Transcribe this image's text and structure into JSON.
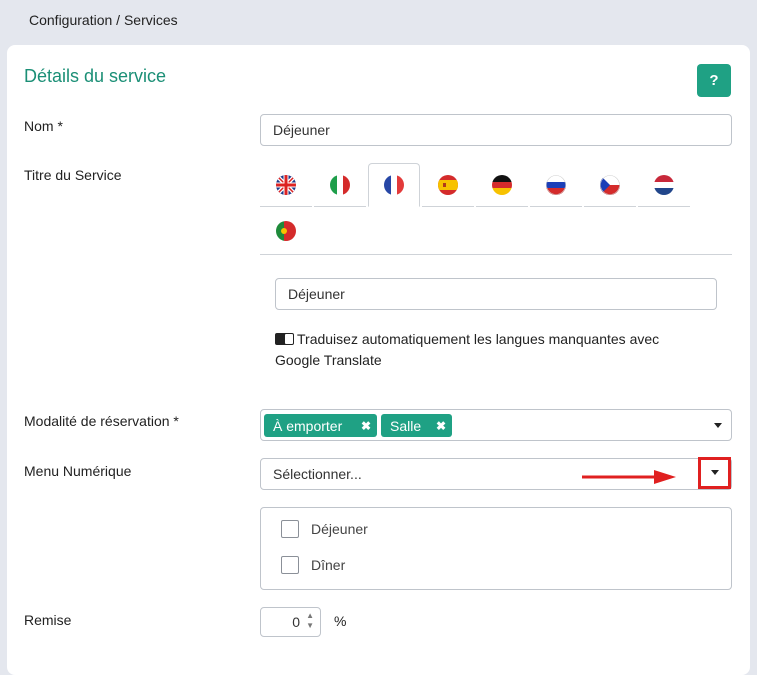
{
  "breadcrumb": "Configuration / Services",
  "card": {
    "title": "Détails du service",
    "help_label": "?"
  },
  "fields": {
    "nom": {
      "label": "Nom *",
      "value": "Déjeuner"
    },
    "titre": {
      "label": "Titre du Service",
      "value": "Déjeuner",
      "flags": [
        "english-flag",
        "italian-flag",
        "french-flag",
        "spanish-flag",
        "german-flag",
        "russian-flag",
        "czech-flag",
        "dutch-flag",
        "portuguese-flag"
      ],
      "active_flag": "french-flag",
      "translate_line1": "Traduisez automatiquement les langues manquantes avec",
      "translate_line2": "Google Translate"
    },
    "modalite": {
      "label": "Modalité de réservation *",
      "tags": [
        "À emporter",
        "Salle"
      ],
      "remove_glyph": "✖"
    },
    "menu": {
      "label": "Menu Numérique",
      "placeholder": "Sélectionner...",
      "options": [
        "Déjeuner",
        "Dîner"
      ]
    },
    "remise": {
      "label": "Remise",
      "value": "0",
      "unit": "%"
    }
  },
  "colors": {
    "accent": "#1fa184",
    "annotation": "#e02020"
  }
}
